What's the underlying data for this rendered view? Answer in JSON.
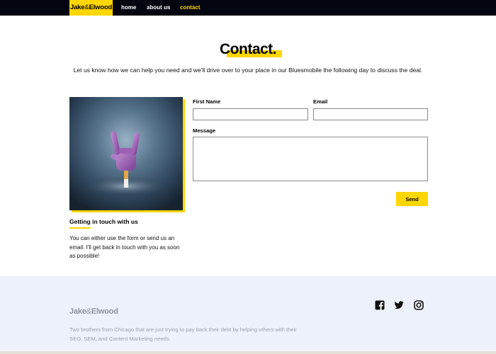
{
  "nav": {
    "logo_left": "Jake",
    "logo_amp": "&",
    "logo_right": "Elwood",
    "links": [
      {
        "label": "home"
      },
      {
        "label": "about us"
      },
      {
        "label": "contact"
      }
    ],
    "active_link": "contact"
  },
  "header": {
    "title": "Contact.",
    "intro": "Let us know how we can help you need and we'll drive over to your place in our Bluesmobile the following day to discuss the deal."
  },
  "side": {
    "image_icon": "rock-hand-image",
    "heading": "Getting in touch with us",
    "text": "You can either use the form or send us an email. I'll get back in touch with you as soon as possible!"
  },
  "form": {
    "first_name_label": "First Name",
    "first_name_value": "",
    "email_label": "Email",
    "email_value": "",
    "message_label": "Message",
    "message_value": "",
    "send_label": "Send"
  },
  "footer": {
    "logo_left": "Jake",
    "logo_amp": "&",
    "logo_right": "Elwood",
    "description": "Two brothers from Chicago that are just trying to pay back their debt by helping others with their SEO, SEM, and Content Marketing needs.",
    "social_icons": [
      "facebook-icon",
      "twitter-icon",
      "instagram-icon"
    ]
  },
  "colors": {
    "accent": "#ffd600",
    "nav_bg": "#03060f",
    "footer_bg": "#edf1fb"
  }
}
